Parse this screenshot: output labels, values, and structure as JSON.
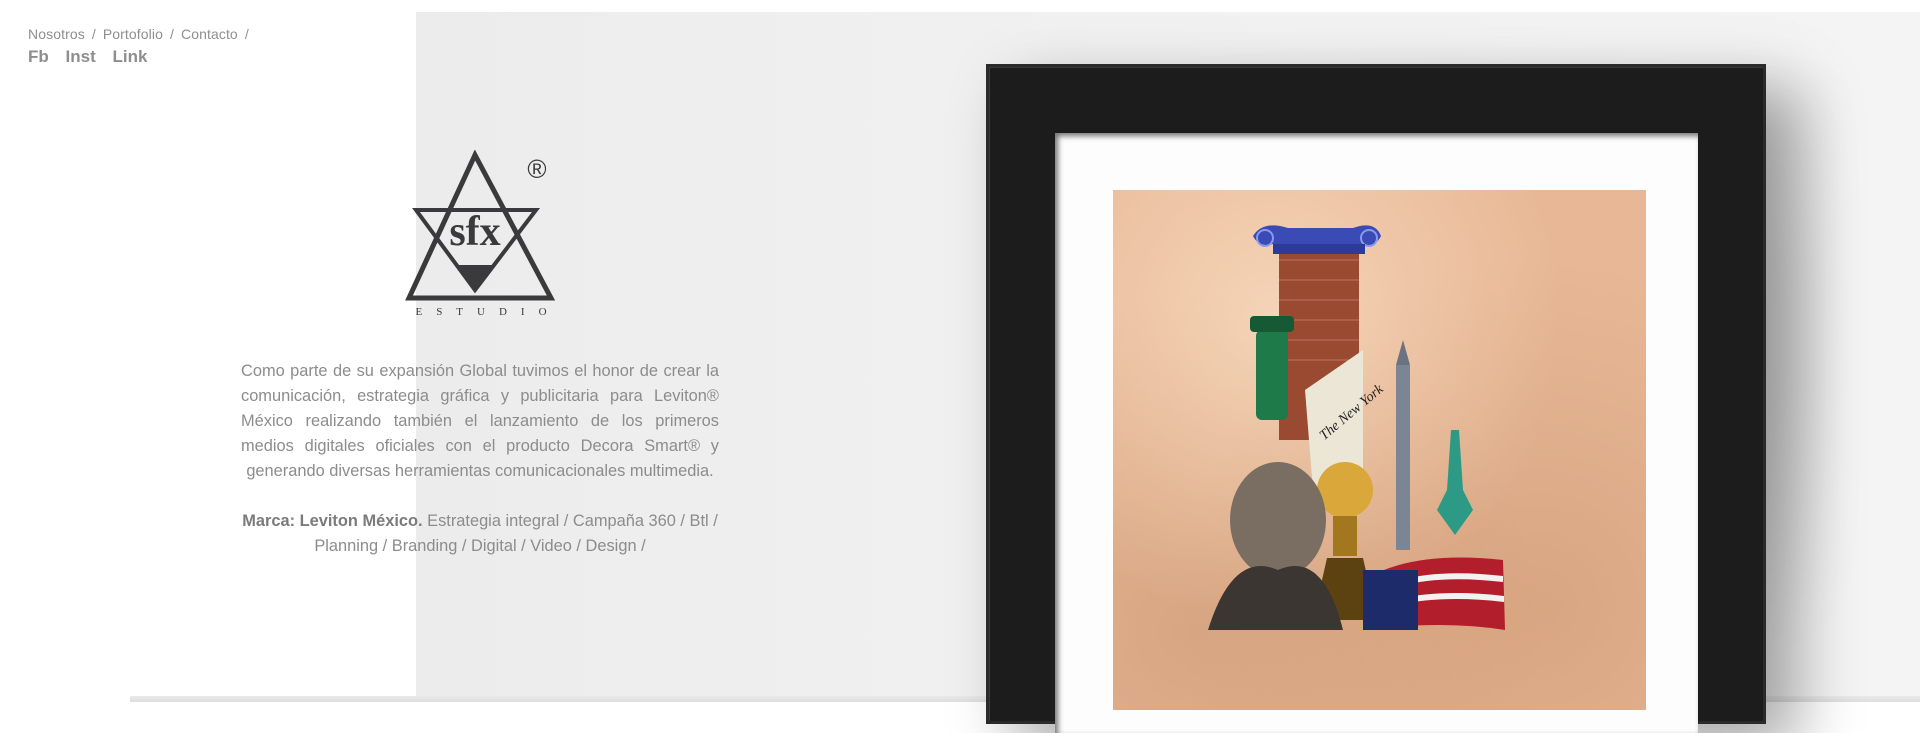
{
  "nav": {
    "items": [
      "Nosotros",
      "Portofolio",
      "Contacto"
    ],
    "separator": "/"
  },
  "social": [
    "Fb",
    "Inst",
    "Link"
  ],
  "logo": {
    "mark": "sfx",
    "registered": "®",
    "subtitle": "ESTUDIO"
  },
  "description": "Como parte de su expansión Global tuvimos el honor de crear la comunicación, estrategia gráfica y publicitaria para Leviton® México realizando también el lanzamiento de los primeros medios digitales oficiales con el producto Decora Smart® y generando diversas herramientas comunicacionales multimedia.",
  "credits": {
    "brand_label": "Marca: Leviton México.",
    "line1_rest": "Estrategia integral / Campaña 360 / Btl  /",
    "line2": "Planning  /  Branding  /  Digital  /   Video  /  Design  /"
  },
  "artwork": {
    "newspaper_text": "The New York"
  },
  "colors": {
    "text_gray": "#8c8c8c",
    "logo_dark": "#3a3a3c",
    "frame": "#1c1c1c",
    "paper": "#e8b896",
    "capital_blue": "#3b4bb5"
  }
}
